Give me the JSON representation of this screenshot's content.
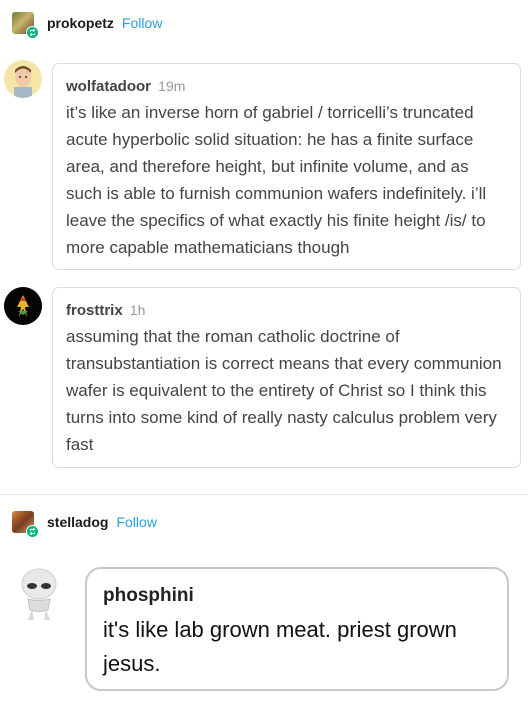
{
  "post1": {
    "username": "prokopetz",
    "follow_label": "Follow"
  },
  "replies": [
    {
      "username": "wolfatadoor",
      "time": "19m",
      "text": "it’s like an inverse horn of gabriel / torricelli’s truncated acute hyperbolic solid situation: he has a finite surface area, and therefore height, but infinite volume, and as such is able to furnish communion wafers indefinitely. i’ll leave the specifics of what exactly his finite height /is/ to more capable mathematicians though"
    },
    {
      "username": "frosttrix",
      "time": "1h",
      "text": "assuming that the roman catholic doctrine of transubstantiation is correct means that every communion wafer is equivalent to the entirety of Christ so I think this turns into some kind of really nasty calculus problem very fast"
    }
  ],
  "post2": {
    "username": "stelladog",
    "follow_label": "Follow"
  },
  "bubble": {
    "username": "phosphini",
    "text": "it's like lab grown meat. priest grown jesus."
  },
  "colors": {
    "follow": "#27a0d8",
    "reblog_badge": "#00b67a"
  }
}
